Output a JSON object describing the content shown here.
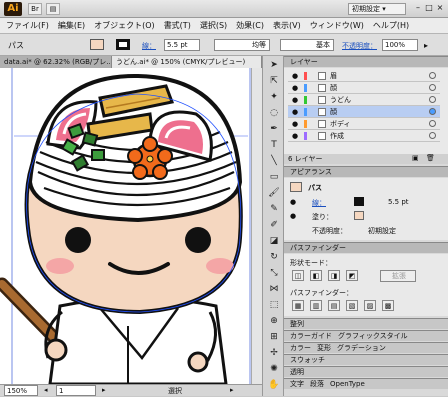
{
  "app": {
    "logo": "Ai",
    "workspace": "初期設定 ▾"
  },
  "menu": [
    "ファイル(F)",
    "編集(E)",
    "オブジェクト(O)",
    "書式(T)",
    "選択(S)",
    "効果(C)",
    "表示(V)",
    "ウィンドウ(W)",
    "ヘルプ(H)"
  ],
  "control": {
    "path_label": "パス",
    "stroke_label": "線：",
    "stroke_value": "5.5 pt",
    "profile1": "均等",
    "profile2": "基本",
    "opacity_label": "不透明度：",
    "opacity_value": "100%"
  },
  "tabs": [
    "data.ai* @ 62.32% (RGB/プレ...",
    "うどん.ai* @ 150% (CMYK/プレビュー)"
  ],
  "status": {
    "zoom": "150%",
    "page": "1",
    "mode": "選択"
  },
  "layers_panel": {
    "title": "レイヤー",
    "rows": [
      {
        "name": "眉",
        "color": "#ff4f4f",
        "selected": false
      },
      {
        "name": "顔",
        "color": "#4a9cff",
        "selected": false
      },
      {
        "name": "うどん",
        "color": "#32c832",
        "selected": false
      },
      {
        "name": "顔",
        "color": "#4a9cff",
        "selected": true
      },
      {
        "name": "ボディ",
        "color": "#ff9a2e",
        "selected": false
      },
      {
        "name": "作成",
        "color": "#9d6bff",
        "selected": false
      }
    ],
    "count": "6 レイヤー"
  },
  "appearance_panel": {
    "title": "アピアランス",
    "item": "パス",
    "stroke_label": "線：",
    "stroke_value": "5.5 pt",
    "fill_label": "塗り：",
    "opacity_label": "不透明度：",
    "opacity_value": "初期設定"
  },
  "pathfinder_panel": {
    "title": "パスファインダー",
    "shape_mode": "形状モード：",
    "expand": "拡張",
    "pathfinder": "パスファインダー："
  },
  "collapsed_panels": [
    "整列",
    "カラーガイド",
    "グラフィックスタイル",
    "カラー",
    "変形",
    "グラデーション",
    "スウォッチ",
    "透明",
    "文字",
    "段落",
    "OpenType"
  ],
  "colors": {
    "skin": "#f5d7c0",
    "cheek": "#f4a6a6",
    "kamaboko": "#ee6f8e",
    "aburaage": "#e7b74a",
    "negi": "#3d9b3d",
    "flower": "#f26a1b"
  }
}
